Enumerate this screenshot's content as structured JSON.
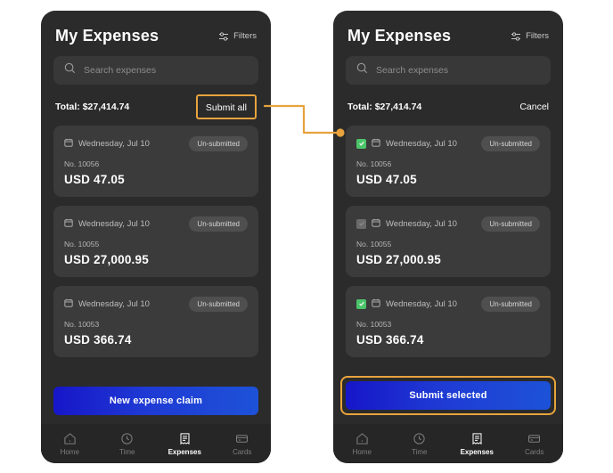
{
  "app": {
    "title": "My Expenses",
    "filters_label": "Filters",
    "search_placeholder": "Search expenses",
    "total_label": "Total: $27,414.74"
  },
  "colors": {
    "highlight": "#e8a33d",
    "checkbox_on": "#4cc46a",
    "checkbox_off": "#6b6b6b",
    "cta_start": "#1616c8",
    "cta_end": "#1d52d8",
    "screen_bg": "#2b2b2b",
    "card_bg": "#3b3b3b"
  },
  "left_panel": {
    "action_label": "Submit all",
    "cta_label": "New expense claim",
    "selection_mode": false,
    "expenses": [
      {
        "date": "Wednesday, Jul 10",
        "status": "Un-submitted",
        "number": "No. 10056",
        "amount": "USD 47.05"
      },
      {
        "date": "Wednesday, Jul 10",
        "status": "Un-submitted",
        "number": "No. 10055",
        "amount": "USD 27,000.95"
      },
      {
        "date": "Wednesday, Jul 10",
        "status": "Un-submitted",
        "number": "No. 10053",
        "amount": "USD 366.74"
      }
    ]
  },
  "right_panel": {
    "action_label": "Cancel",
    "cta_label": "Submit selected",
    "selection_mode": true,
    "expenses": [
      {
        "date": "Wednesday, Jul 10",
        "status": "Un-submitted",
        "number": "No. 10056",
        "amount": "USD 47.05",
        "checked": true
      },
      {
        "date": "Wednesday, Jul 10",
        "status": "Un-submitted",
        "number": "No. 10055",
        "amount": "USD 27,000.95",
        "checked": false
      },
      {
        "date": "Wednesday, Jul 10",
        "status": "Un-submitted",
        "number": "No. 10053",
        "amount": "USD 366.74",
        "checked": true
      }
    ]
  },
  "nav": {
    "items": [
      {
        "label": "Home",
        "icon": "home-icon",
        "active": false
      },
      {
        "label": "Time",
        "icon": "clock-icon",
        "active": false
      },
      {
        "label": "Expenses",
        "icon": "receipt-icon",
        "active": true
      },
      {
        "label": "Cards",
        "icon": "card-icon",
        "active": false
      }
    ]
  }
}
